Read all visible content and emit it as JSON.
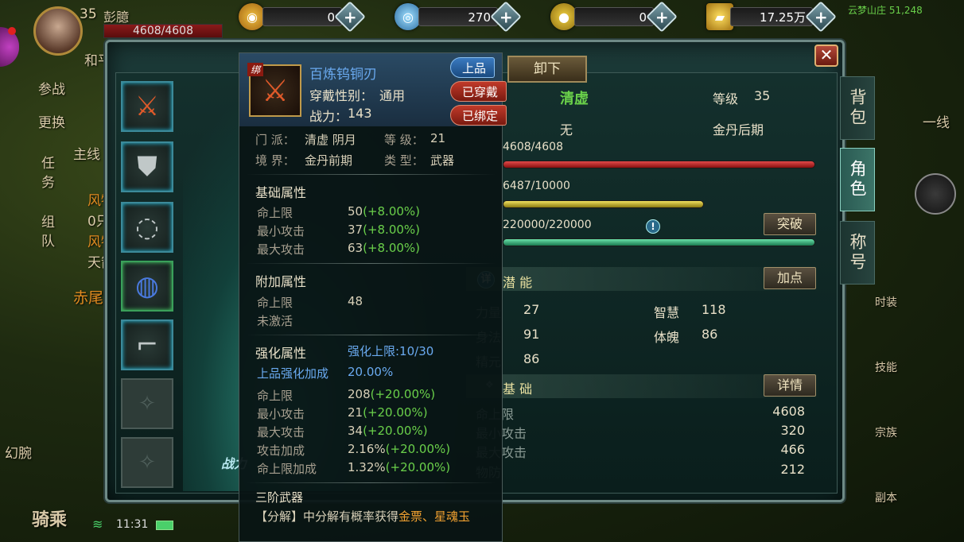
{
  "hud": {
    "currencies": [
      {
        "icon": "gold-phoenix-coin-icon",
        "glyph": "◉",
        "color": "#d89a2a",
        "value": "0"
      },
      {
        "icon": "jade-disc-icon",
        "glyph": "◎",
        "color": "#3a8ad0",
        "value": "270"
      },
      {
        "icon": "copper-coins-icon",
        "glyph": "●",
        "color": "#c8a020",
        "value": "0"
      },
      {
        "icon": "gold-ingot-icon",
        "glyph": "▰",
        "color": "#d0a020",
        "value": "17.25万"
      }
    ],
    "plus": "+",
    "location": "云梦山庄 51,248"
  },
  "player": {
    "level": "35",
    "name": "彭臆",
    "hp": "4608/4608",
    "peace": "和平"
  },
  "left_buttons": [
    "参战",
    "更换",
    "主线",
    "任务",
    "组队",
    "赤尾",
    "幻腕",
    "骑乘"
  ],
  "right_buttons": [
    "一线",
    "时装",
    "技能",
    "宗族",
    "副本"
  ],
  "side_text": {
    "wind": "风物",
    "tian": "天箭",
    "zero": "0只"
  },
  "status": {
    "time": "11:31"
  },
  "panel": {
    "close": "✕",
    "tabs": [
      "背包",
      "角色",
      "称号"
    ],
    "power_label": "战力"
  },
  "character": {
    "sect": "清虚",
    "level_label": "等级",
    "level": "35",
    "title": "无",
    "realm": "金丹后期",
    "hp": "4608/4608",
    "mp": "6487/10000",
    "exp": "220000/220000",
    "breakthrough": "突破",
    "potential_label": "潜 能",
    "add_points": "加点",
    "stats": [
      {
        "label": "力量",
        "value": "27"
      },
      {
        "label": "智慧",
        "value": "118"
      },
      {
        "label": "身法",
        "value": "91"
      },
      {
        "label": "体魄",
        "value": "86"
      },
      {
        "label": "精元",
        "value": "86"
      }
    ],
    "basic_label": "基 础",
    "details": "详情",
    "basic": [
      {
        "label": "命上限",
        "value": "4608"
      },
      {
        "label": "最小攻击",
        "value": "320"
      },
      {
        "label": "最大攻击",
        "value": "466"
      },
      {
        "label": "物防",
        "value": "212"
      }
    ],
    "detail_badge": "详"
  },
  "tooltip": {
    "bind": "绑",
    "name": "百炼钨铜刃",
    "gender_label": "穿戴性别：",
    "gender": "通用",
    "power_label": "战力：",
    "power": "143",
    "tags": {
      "quality": "上品",
      "worn": "已穿戴",
      "bound": "已绑定"
    },
    "unequip": "卸下",
    "sect_label": "门  派：",
    "sect": "清虚 阴月",
    "level_label": "等  级：",
    "level": "21",
    "realm_label": "境  界：",
    "realm": "金丹前期",
    "type_label": "类  型：",
    "type": "武器",
    "base_title": "基础属性",
    "base": [
      {
        "label": "命上限",
        "value": "50",
        "bonus": "(+8.00%)"
      },
      {
        "label": "最小攻击",
        "value": "37",
        "bonus": "(+8.00%)"
      },
      {
        "label": "最大攻击",
        "value": "63",
        "bonus": "(+8.00%)"
      }
    ],
    "extra_title": "附加属性",
    "extra": [
      {
        "label": "命上限",
        "value": "48"
      },
      {
        "label": "未激活",
        "value": ""
      }
    ],
    "enhance_title": "强化属性",
    "enhance_cap": "强化上限:10/30",
    "enhance_bonus_label": "上品强化加成",
    "enhance_bonus": "20.00%",
    "enhance": [
      {
        "label": "命上限",
        "value": "208",
        "bonus": "(+20.00%)"
      },
      {
        "label": "最小攻击",
        "value": "21",
        "bonus": "(+20.00%)"
      },
      {
        "label": "最大攻击",
        "value": "34",
        "bonus": "(+20.00%)"
      },
      {
        "label": "攻击加成",
        "value": "2.16%",
        "bonus": "(+20.00%)"
      },
      {
        "label": "命上限加成",
        "value": "1.32%",
        "bonus": "(+20.00%)"
      }
    ],
    "tier": "三阶武器",
    "decompose_pre": "【分解】中分解有概率获得",
    "decompose_items": "金票、星魂玉"
  },
  "slots": [
    {
      "icon": "sword-icon",
      "glyph": "⚔"
    },
    {
      "icon": "armor-icon",
      "glyph": "⛊"
    },
    {
      "icon": "necklace-icon",
      "glyph": "◌"
    },
    {
      "icon": "ring-icon",
      "glyph": "◍"
    },
    {
      "icon": "boots-icon",
      "glyph": "⌐"
    },
    {
      "icon": "empty-slot-icon",
      "glyph": "✧"
    },
    {
      "icon": "empty-slot-icon",
      "glyph": "✧"
    }
  ]
}
